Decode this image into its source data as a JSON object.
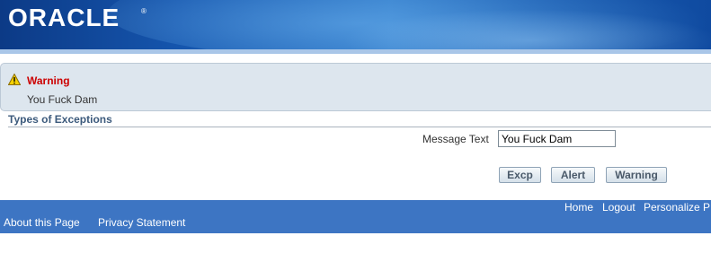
{
  "header": {
    "logo_text": "ORACLE",
    "logo_mark": "®"
  },
  "message": {
    "icon": "warning-icon",
    "title": "Warning",
    "text": "You Fuck Dam"
  },
  "section": {
    "title": "Types of Exceptions"
  },
  "form": {
    "message_text_label": "Message Text",
    "message_text_value": "You Fuck Dam"
  },
  "buttons": {
    "excp": "Excp",
    "alert": "Alert",
    "warning": "Warning"
  },
  "footer": {
    "global_links": [
      "Home",
      "Logout",
      "Personalize P"
    ],
    "page_links": [
      "About this Page",
      "Privacy Statement"
    ]
  },
  "colors": {
    "warning_title": "#cc0000",
    "footer_bar": "#3d75c3",
    "section_title": "#3c5a7c"
  }
}
